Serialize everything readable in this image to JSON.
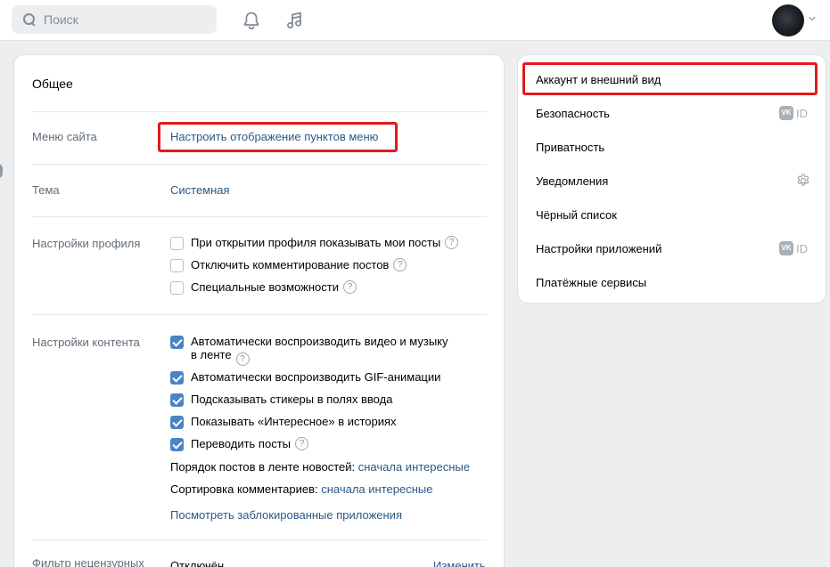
{
  "header": {
    "search_placeholder": "Поиск",
    "icons": [
      "bell-icon",
      "music-icon"
    ]
  },
  "panel": {
    "title": "Общее",
    "site_menu": {
      "label": "Меню сайта",
      "link": "Настроить отображение пунктов меню"
    },
    "theme": {
      "label": "Тема",
      "value": "Системная"
    },
    "profile": {
      "label": "Настройки профиля",
      "options": [
        {
          "text": "При открытии профиля показывать мои посты",
          "checked": false,
          "help": "?"
        },
        {
          "text": "Отключить комментирование постов",
          "checked": false,
          "help": "?"
        },
        {
          "text": "Специальные возможности",
          "checked": false,
          "help": "?"
        }
      ]
    },
    "content": {
      "label": "Настройки контента",
      "options": [
        {
          "text_line1": "Автоматически воспроизводить видео и музыку",
          "text_line2": "в ленте",
          "checked": true,
          "help": "?"
        },
        {
          "text": "Автоматически воспроизводить GIF-анимации",
          "checked": true
        },
        {
          "text": "Подсказывать стикеры в полях ввода",
          "checked": true
        },
        {
          "text": "Показывать «Интересное» в историях",
          "checked": true
        },
        {
          "text": "Переводить посты",
          "checked": true,
          "help": "?"
        }
      ],
      "feed_order_label": "Порядок постов в ленте новостей:",
      "feed_order_value": "сначала интересные",
      "comments_sort_label": "Сортировка комментариев:",
      "comments_sort_value": "сначала интересные",
      "blocked_apps_link": "Посмотреть заблокированные приложения"
    },
    "filter": {
      "label": "Фильтр нецензурных",
      "value": "Отключён",
      "action": "Изменить"
    }
  },
  "sidebar": {
    "items": [
      {
        "label": "Аккаунт и внешний вид",
        "active": true
      },
      {
        "label": "Безопасность",
        "badge": "ID"
      },
      {
        "label": "Приватность"
      },
      {
        "label": "Уведомления"
      },
      {
        "label": "Чёрный список"
      },
      {
        "label": "Настройки приложений",
        "badge": "ID"
      },
      {
        "label": "Платёжные сервисы"
      }
    ],
    "vk_logo_text": "VK"
  },
  "colors": {
    "link": "#2a5885",
    "checkbox": "#4b84c6",
    "highlight": "#e3191c",
    "background": "#edeef0"
  }
}
